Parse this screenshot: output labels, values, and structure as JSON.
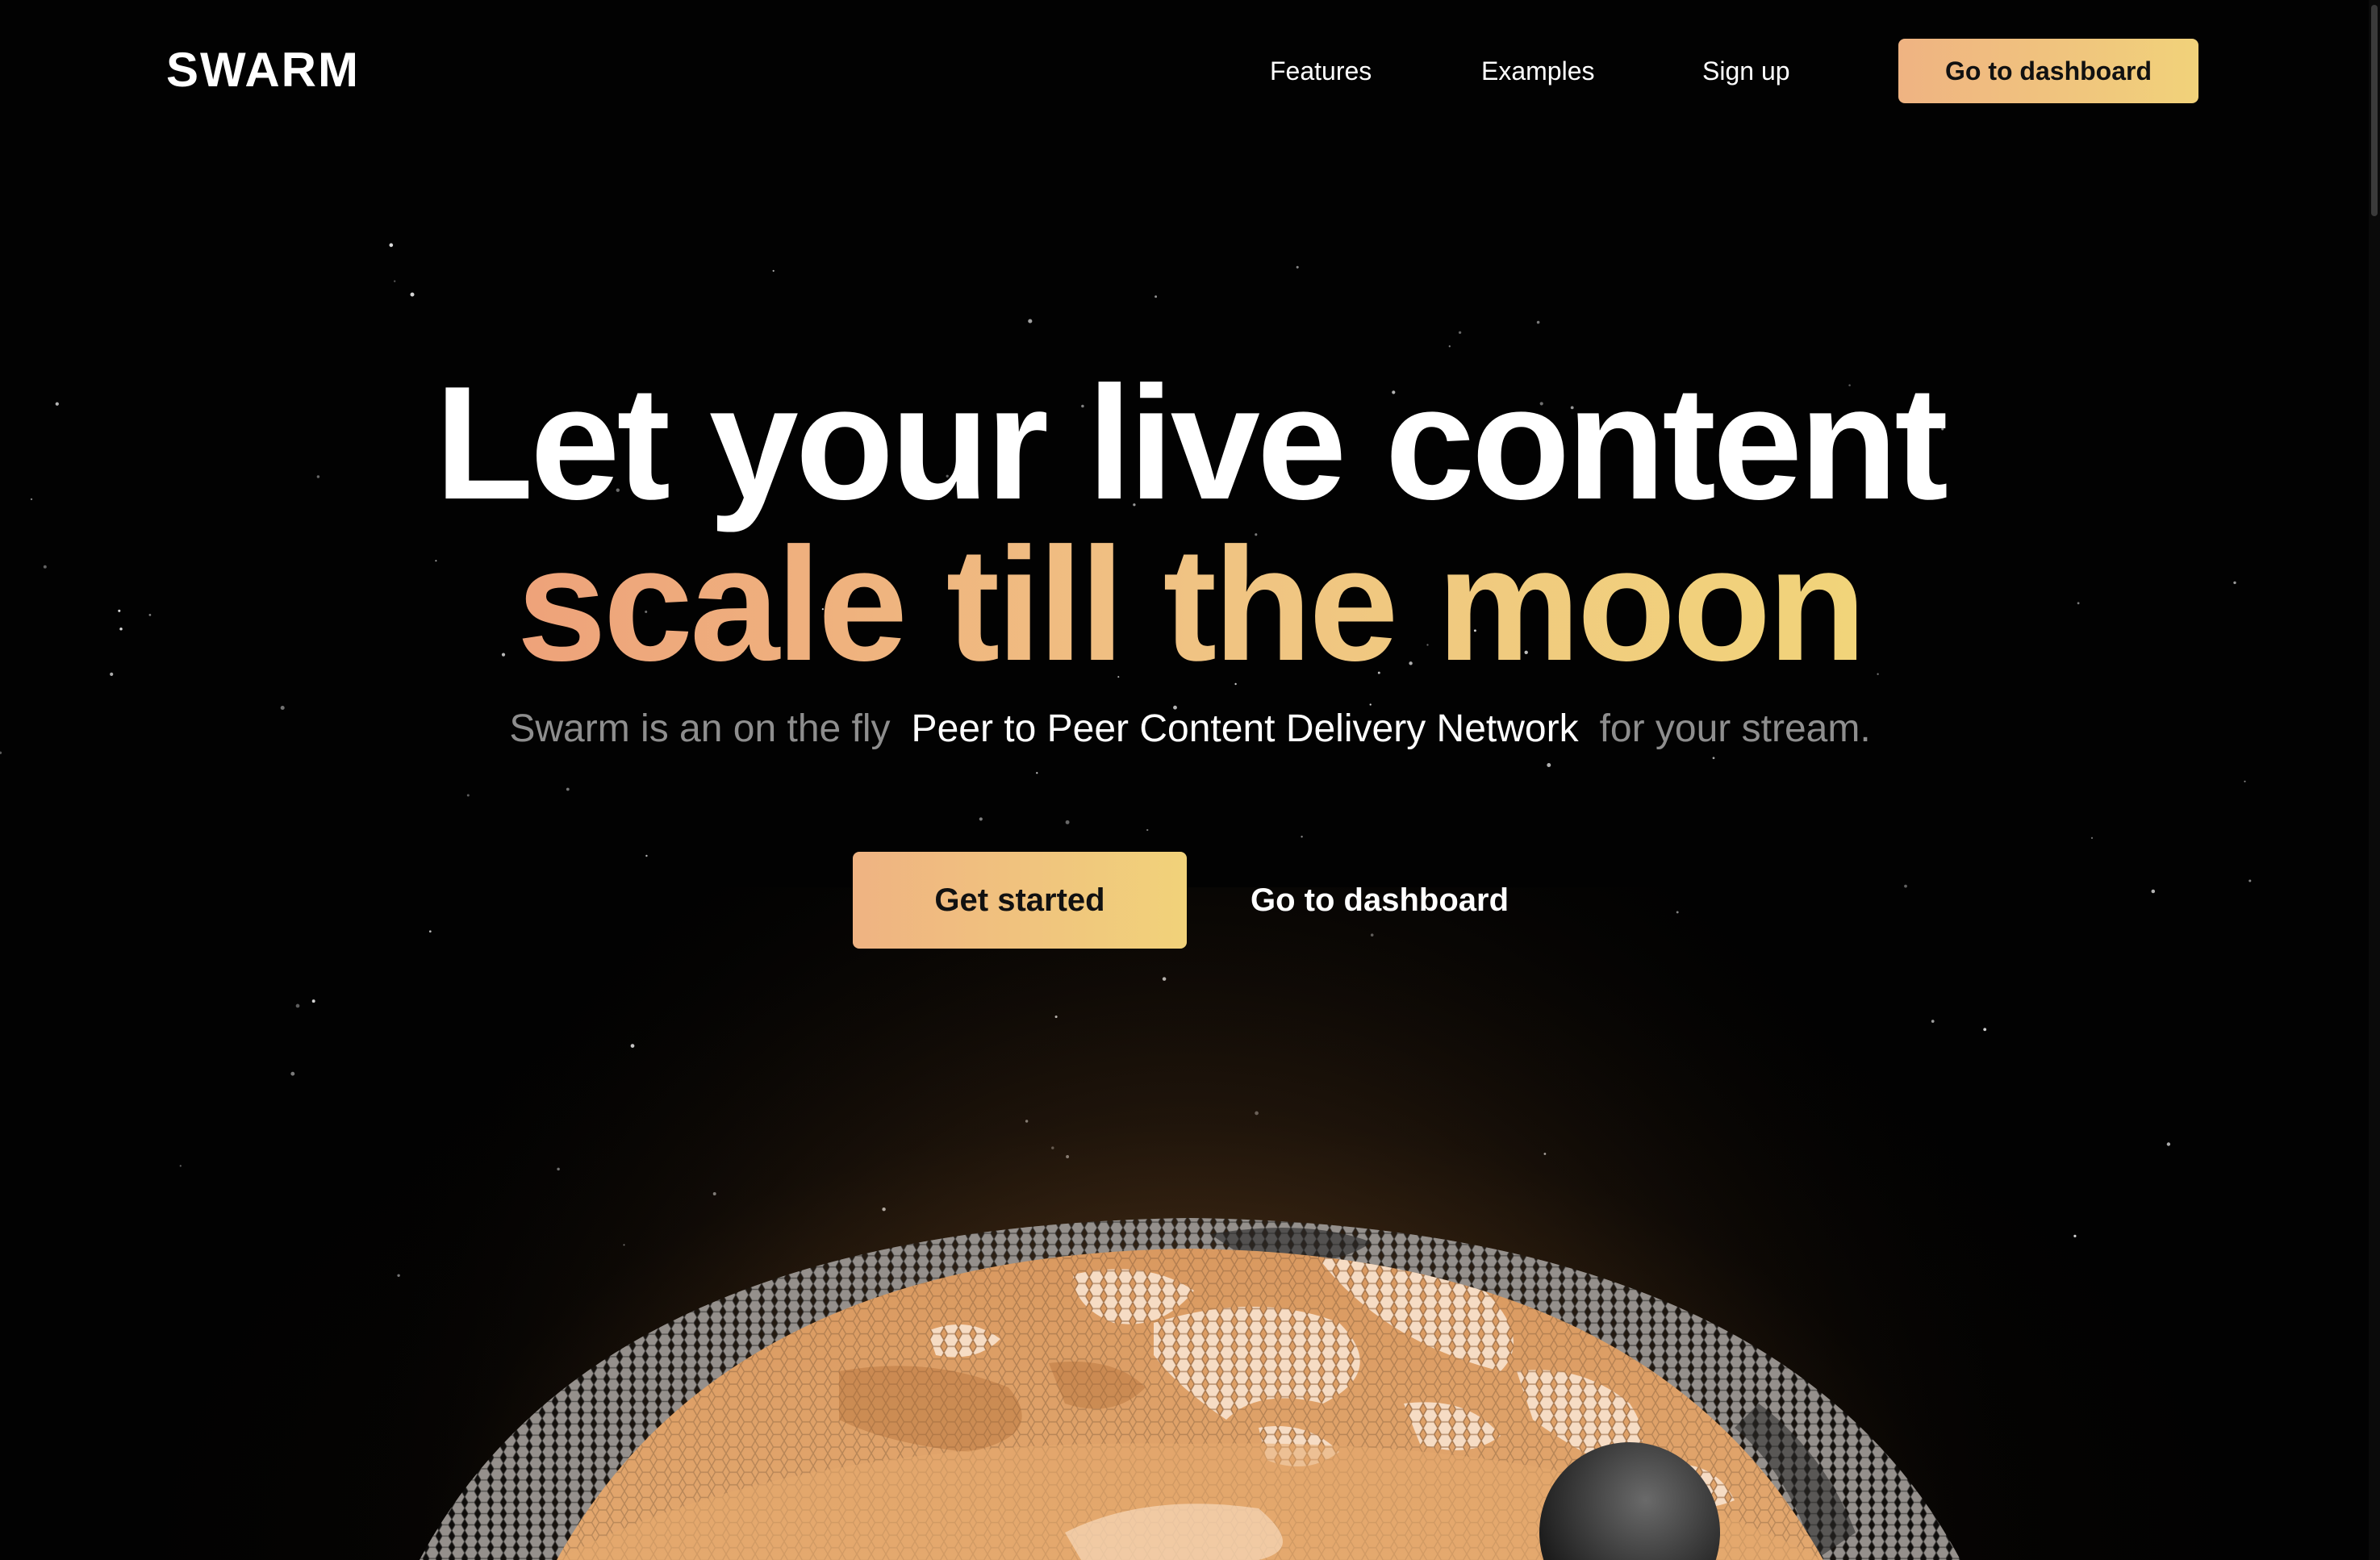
{
  "header": {
    "logo": "SWARM",
    "nav": {
      "features": "Features",
      "examples": "Examples",
      "signup": "Sign up",
      "cta": "Go to dashboard"
    }
  },
  "hero": {
    "headline_line1": "Let your live content",
    "headline_line2": "scale till the moon",
    "subtitle_pre": "Swarm is an on the fly",
    "subtitle_highlight": "Peer to Peer Content Delivery Network",
    "subtitle_post": "for your stream.",
    "primary_button": "Get started",
    "secondary_button": "Go to dashboard"
  },
  "colors": {
    "background": "#000000",
    "accent_start": "#efb382",
    "accent_end": "#f1d27a",
    "muted_text": "#8e8e8e",
    "globe_base": "#d9935a"
  },
  "illustration": {
    "name": "hexagon-globe",
    "icon": "globe-icon"
  }
}
